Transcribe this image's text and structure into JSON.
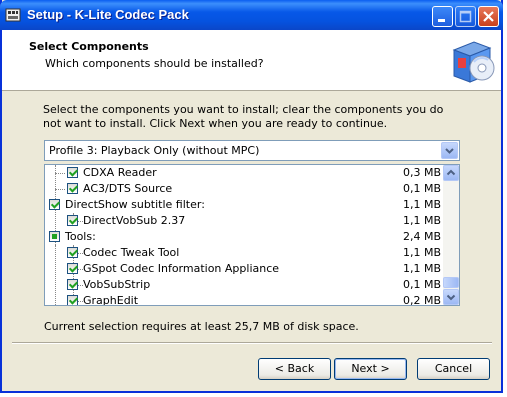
{
  "window": {
    "title": "Setup - K-Lite Codec Pack"
  },
  "header": {
    "title": "Select Components",
    "subtitle": "Which components should be installed?"
  },
  "instruction": "Select the components you want to install; clear the components you do not want to install. Click Next when you are ready to continue.",
  "profile": {
    "selected": "Profile 3: Playback Only (without MPC)"
  },
  "components": [
    {
      "label": "CDXA Reader",
      "size": "0,3 MB",
      "state": "checked"
    },
    {
      "label": "AC3/DTS Source",
      "size": "0,1 MB",
      "state": "checked"
    },
    {
      "label": "DirectShow subtitle filter:",
      "size": "1,1 MB",
      "state": "checked"
    },
    {
      "label": "DirectVobSub 2.37",
      "size": "1,1 MB",
      "state": "checked"
    },
    {
      "label": "Tools:",
      "size": "2,4 MB",
      "state": "partial"
    },
    {
      "label": "Codec Tweak Tool",
      "size": "1,1 MB",
      "state": "checked"
    },
    {
      "label": "GSpot Codec Information Appliance",
      "size": "1,1 MB",
      "state": "checked"
    },
    {
      "label": "VobSubStrip",
      "size": "0,1 MB",
      "state": "checked"
    },
    {
      "label": "GraphEdit",
      "size": "0,2 MB",
      "state": "checked"
    }
  ],
  "disk_space_text": "Current selection requires at least 25,7 MB of disk space.",
  "buttons": {
    "back": "< Back",
    "next": "Next >",
    "cancel": "Cancel"
  },
  "colors": {
    "titlebar": "#0553e0",
    "accent_check": "#21a121",
    "dialog_bg": "#ece9d8"
  }
}
